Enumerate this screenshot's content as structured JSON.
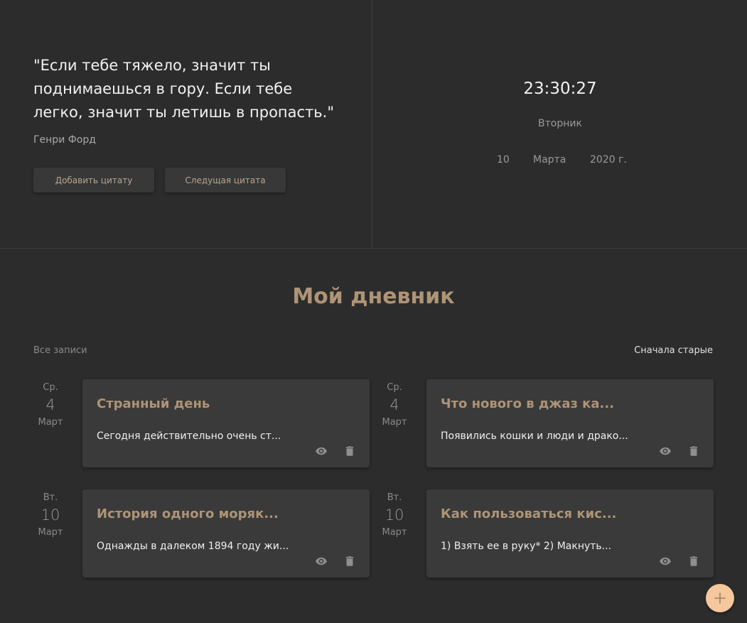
{
  "quote": {
    "text": "\"Если тебе тяжело, значит ты поднимаешься в гору. Если тебе легко, значит ты летишь в пропасть.\"",
    "author": "Генри Форд",
    "add_label": "Добавить цитату",
    "next_label": "Следущая цитата"
  },
  "clock": {
    "time": "23:30:27",
    "weekday": "Вторник",
    "day": "10",
    "month": "Марта",
    "year": "2020 г."
  },
  "diary": {
    "title": "Мой дневник",
    "filter_label": "Все записи",
    "sort_label": "Сначала старые",
    "entries": [
      {
        "weekday": "Ср.",
        "day": "4",
        "month": "Март",
        "title": "Странный день",
        "preview": "Сегодня действительно очень ст..."
      },
      {
        "weekday": "Ср.",
        "day": "4",
        "month": "Март",
        "title": "Что нового в джаз ка...",
        "preview": "Появились кошки и люди и драко..."
      },
      {
        "weekday": "Вт.",
        "day": "10",
        "month": "Март",
        "title": "История одного моряк...",
        "preview": "Однажды в далеком 1894 году жи..."
      },
      {
        "weekday": "Вт.",
        "day": "10",
        "month": "Март",
        "title": "Как пользоваться кис...",
        "preview": "1) Взять ее в руку* 2) Макнуть..."
      }
    ]
  },
  "icons": {
    "view": "eye-icon",
    "delete": "trash-icon",
    "add": "plus-icon"
  },
  "colors": {
    "background": "#2c2c2c",
    "card": "#3a3a3a",
    "accent": "#ae9476",
    "fab": "#f4c89c"
  }
}
